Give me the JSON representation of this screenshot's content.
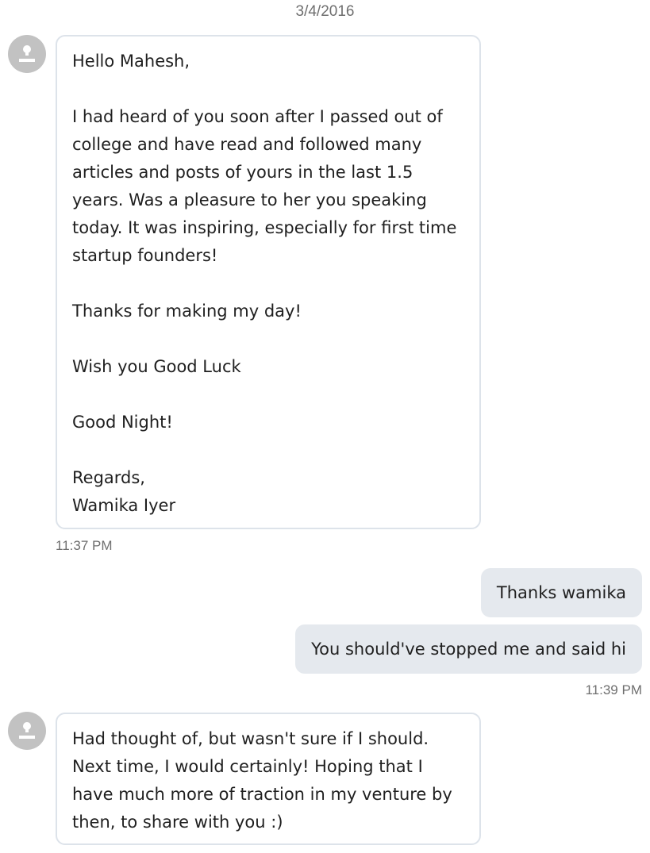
{
  "date_separator": "3/4/2016",
  "messages": [
    {
      "direction": "incoming",
      "icon": "person-avatar-icon",
      "text": "Hello Mahesh,\n\nI had heard of you soon after I passed out of college and have read and followed many articles and posts of yours in the last 1.5 years. Was a pleasure to her you speaking today. It was inspiring, especially for first time startup founders!\n\nThanks for making my day!\n\nWish you Good Luck\n\nGood Night!\n\nRegards,\nWamika Iyer",
      "time": "11:37 PM"
    },
    {
      "direction": "outgoing",
      "text": "Thanks wamika"
    },
    {
      "direction": "outgoing",
      "text": "You should've stopped me and said hi",
      "time": "11:39 PM"
    },
    {
      "direction": "incoming",
      "icon": "person-avatar-icon",
      "text": "Had thought of, but wasn't sure if I should. Next time, I would certainly! Hoping that I have much more of traction in my venture by then, to share with you :)"
    }
  ],
  "colors": {
    "incoming_bubble_border": "#dde3ea",
    "outgoing_bubble_bg": "#e5e9ee",
    "avatar_bg": "#c2c2c2",
    "timestamp_text": "#6f6f6f"
  }
}
